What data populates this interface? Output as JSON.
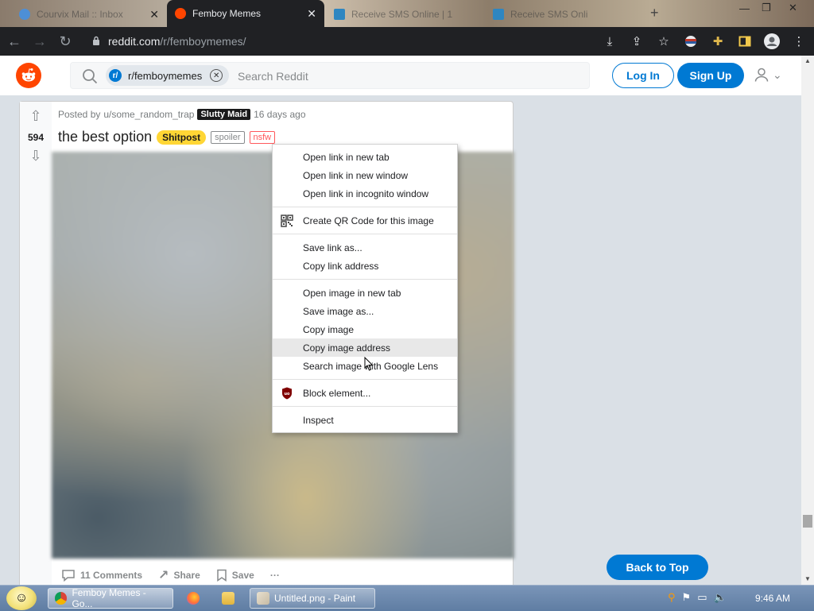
{
  "browser": {
    "tabs": [
      {
        "title": "Courvix Mail :: Inbox",
        "active": false
      },
      {
        "title": "Femboy Memes",
        "active": true
      },
      {
        "title": "Receive SMS Online | 1",
        "active": false
      },
      {
        "title": "Receive SMS Onli",
        "active": false
      }
    ],
    "new_tab_symbol": "+",
    "window_controls": [
      "—",
      "❐",
      "✕"
    ],
    "url_host": "reddit.com",
    "url_path": "/r/femboymemes/"
  },
  "reddit": {
    "search_chip": "r/femboymemes",
    "search_placeholder": "Search Reddit",
    "login_label": "Log In",
    "signup_label": "Sign Up"
  },
  "post": {
    "posted_by_prefix": "Posted by",
    "author": "u/some_random_trap",
    "author_flair": "Slutty Maid",
    "time_ago": "16 days ago",
    "score": "594",
    "title": "the best option",
    "post_flair": "Shitpost",
    "tag_spoiler": "spoiler",
    "tag_nsfw": "nsfw",
    "comments_label": "11 Comments",
    "share_label": "Share",
    "save_label": "Save",
    "more_label": "···"
  },
  "back_to_top_label": "Back to Top",
  "context_menu": {
    "groups": [
      [
        "Open link in new tab",
        "Open link in new window",
        "Open link in incognito window"
      ],
      [
        "Create QR Code for this image"
      ],
      [
        "Save link as...",
        "Copy link address"
      ],
      [
        "Open image in new tab",
        "Save image as...",
        "Copy image",
        "Copy image address",
        "Search image with Google Lens"
      ],
      [
        "Block element..."
      ],
      [
        "Inspect"
      ]
    ],
    "hovered_item": "Copy image address"
  },
  "taskbar": {
    "buttons": [
      {
        "label": "Femboy Memes - Go...",
        "app": "chrome"
      },
      {
        "label": "",
        "app": "firefox"
      },
      {
        "label": "",
        "app": "explorer"
      },
      {
        "label": "Untitled.png - Paint",
        "app": "paint"
      }
    ],
    "clock": "9:46 AM"
  },
  "colors": {
    "reddit_orange": "#ff4500",
    "reddit_blue": "#0079d3",
    "flair_yellow": "#ffd635",
    "nsfw_red": "#ff585b"
  }
}
